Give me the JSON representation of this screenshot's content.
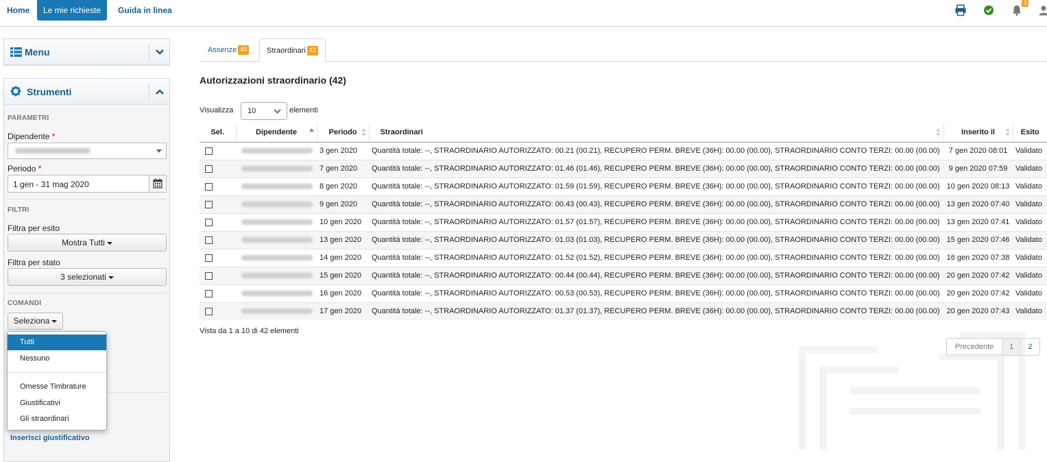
{
  "topnav": {
    "home": "Home",
    "requests": "Le mie richieste",
    "guide": "Guida in linea",
    "notifications_count": "3"
  },
  "icons": {
    "print": "printer-icon",
    "status": "check-circle-icon",
    "bell": "bell-icon",
    "user": "user-icon"
  },
  "menu_panel": {
    "title": "Menu"
  },
  "tools_panel": {
    "title": "Strumenti",
    "params_title": "PARAMETRI",
    "employee_label": "Dipendente",
    "period_label": "Periodo",
    "period_value": "1 gen - 31 mag 2020",
    "filters_title": "FILTRI",
    "filter_outcome_label": "Filtra per esito",
    "filter_outcome_value": "Mostra Tutti",
    "filter_state_label": "Filtra per stato",
    "filter_state_value": "3 selezionati",
    "commands_title": "COMANDI",
    "select_button": "Seleziona",
    "insert_link": "Inserisci giustificativo"
  },
  "select_menu": {
    "items": [
      "Tutti",
      "Nessuno",
      "Omesse Timbrature",
      "Giustificativi",
      "Gli straordinari"
    ]
  },
  "tabs": [
    {
      "label": "Assenze",
      "badge": "40"
    },
    {
      "label": "Straordinari",
      "badge": "42"
    }
  ],
  "main": {
    "title": "Autorizzazioni straordinario (42)",
    "length_label": "Visualizza",
    "length_value": "10",
    "length_suffix": "elementi"
  },
  "table": {
    "headers": [
      "Sel.",
      "Dipendente",
      "Periodo",
      "Straordinari",
      "Inserito il",
      "Esito"
    ],
    "rows": [
      {
        "periodo": "3 gen 2020",
        "straordinari": "Quantità totale: --, STRAORDINARIO AUTORIZZATO: 00.21 (00.21), RECUPERO PERM. BREVE (36H): 00.00 (00.00), STRAORDINARIO CONTO TERZI: 00.00 (00.00)",
        "inserito": "7 gen 2020 08:01",
        "esito": "Validato"
      },
      {
        "periodo": "7 gen 2020",
        "straordinari": "Quantità totale: --, STRAORDINARIO AUTORIZZATO: 01.46 (01.46), RECUPERO PERM. BREVE (36H): 00.00 (00.00), STRAORDINARIO CONTO TERZI: 00.00 (00.00)",
        "inserito": "9 gen 2020 07:59",
        "esito": "Validato"
      },
      {
        "periodo": "8 gen 2020",
        "straordinari": "Quantità totale: --, STRAORDINARIO AUTORIZZATO: 01.59 (01.59), RECUPERO PERM. BREVE (36H): 00.00 (00.00), STRAORDINARIO CONTO TERZI: 00.00 (00.00)",
        "inserito": "10 gen 2020 08:13",
        "esito": "Validato"
      },
      {
        "periodo": "9 gen 2020",
        "straordinari": "Quantità totale: --, STRAORDINARIO AUTORIZZATO: 00.43 (00.43), RECUPERO PERM. BREVE (36H): 00.00 (00.00), STRAORDINARIO CONTO TERZI: 00.00 (00.00)",
        "inserito": "13 gen 2020 07:40",
        "esito": "Validato"
      },
      {
        "periodo": "10 gen 2020",
        "straordinari": "Quantità totale: --, STRAORDINARIO AUTORIZZATO: 01.57 (01.57), RECUPERO PERM. BREVE (36H): 00.00 (00.00), STRAORDINARIO CONTO TERZI: 00.00 (00.00)",
        "inserito": "13 gen 2020 07:41",
        "esito": "Validato"
      },
      {
        "periodo": "13 gen 2020",
        "straordinari": "Quantità totale: --, STRAORDINARIO AUTORIZZATO: 01.03 (01.03), RECUPERO PERM. BREVE (36H): 00.00 (00.00), STRAORDINARIO CONTO TERZI: 00.00 (00.00)",
        "inserito": "15 gen 2020 07:46",
        "esito": "Validato"
      },
      {
        "periodo": "14 gen 2020",
        "straordinari": "Quantità totale: --, STRAORDINARIO AUTORIZZATO: 01.52 (01.52), RECUPERO PERM. BREVE (36H): 00.00 (00.00), STRAORDINARIO CONTO TERZI: 00.00 (00.00)",
        "inserito": "16 gen 2020 07:38",
        "esito": "Validato"
      },
      {
        "periodo": "15 gen 2020",
        "straordinari": "Quantità totale: --, STRAORDINARIO AUTORIZZATO: 00.44 (00.44), RECUPERO PERM. BREVE (36H): 00.00 (00.00), STRAORDINARIO CONTO TERZI: 00.00 (00.00)",
        "inserito": "20 gen 2020 07:42",
        "esito": "Validato"
      },
      {
        "periodo": "16 gen 2020",
        "straordinari": "Quantità totale: --, STRAORDINARIO AUTORIZZATO: 00.53 (00.53), RECUPERO PERM. BREVE (36H): 00.00 (00.00), STRAORDINARIO CONTO TERZI: 00.00 (00.00)",
        "inserito": "20 gen 2020 07:42",
        "esito": "Validato"
      },
      {
        "periodo": "17 gen 2020",
        "straordinari": "Quantità totale: --, STRAORDINARIO AUTORIZZATO: 01.37 (01.37), RECUPERO PERM. BREVE (36H): 00.00 (00.00), STRAORDINARIO CONTO TERZI: 00.00 (00.00)",
        "inserito": "20 gen 2020 07:43",
        "esito": "Validato"
      }
    ]
  },
  "footer": {
    "info": "Vista da 1 a 10 di 42 elementi",
    "prev": "Precedente",
    "pages": [
      "1",
      "2"
    ]
  },
  "colors": {
    "brand": "#1a78b4",
    "link": "#1a5d8a",
    "badge": "#f0a020",
    "validated": "#3a8a1a"
  }
}
